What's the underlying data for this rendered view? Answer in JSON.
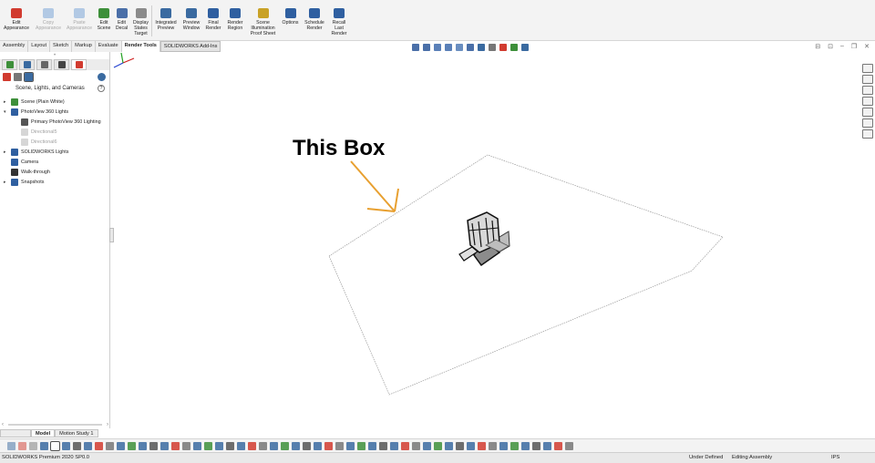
{
  "ribbon": {
    "buttons": [
      {
        "label": "Edit\nAppearance",
        "icon": "edit-appearance-icon",
        "enabled": true,
        "color": "#d13b2f"
      },
      {
        "label": "Copy\nAppearance",
        "icon": "copy-appearance-icon",
        "enabled": false,
        "color": "#3a7bc8"
      },
      {
        "label": "Paste\nAppearance",
        "icon": "paste-appearance-icon",
        "enabled": false,
        "color": "#3a7bc8"
      },
      {
        "label": "Edit\nScene",
        "icon": "edit-scene-icon",
        "enabled": true,
        "color": "#3d8f3a"
      },
      {
        "label": "Edit\nDecal",
        "icon": "edit-decal-icon",
        "enabled": true,
        "color": "#4a6fa8"
      },
      {
        "label": "Display\nStates\nTarget",
        "icon": "display-states-icon",
        "enabled": true,
        "color": "#8a8a8a"
      },
      {
        "label": "Integrated\nPreview",
        "icon": "integrated-preview-icon",
        "enabled": true,
        "color": "#3a6aa0"
      },
      {
        "label": "Preview\nWindow",
        "icon": "preview-window-icon",
        "enabled": true,
        "color": "#3a6aa0"
      },
      {
        "label": "Final\nRender",
        "icon": "final-render-icon",
        "enabled": true,
        "color": "#2f5fa0"
      },
      {
        "label": "Render\nRegion",
        "icon": "render-region-icon",
        "enabled": true,
        "color": "#2f5fa0"
      },
      {
        "label": "Scene\nIllumination\nProof Sheet",
        "icon": "proof-sheet-icon",
        "enabled": true,
        "color": "#c9a227"
      },
      {
        "label": "Options",
        "icon": "options-icon",
        "enabled": true,
        "color": "#2f5fa0"
      },
      {
        "label": "Schedule\nRender",
        "icon": "schedule-render-icon",
        "enabled": true,
        "color": "#2f5fa0"
      },
      {
        "label": "Recall\nLast\nRender",
        "icon": "recall-render-icon",
        "enabled": true,
        "color": "#2f5fa0"
      }
    ]
  },
  "tabs": [
    "Assembly",
    "Layout",
    "Sketch",
    "Markup",
    "Evaluate",
    "Render Tools",
    "SOLIDWORKS Add-Ins"
  ],
  "active_tab": "Render Tools",
  "window_controls": [
    "⊟",
    "⊡",
    "–",
    "❐",
    "✕"
  ],
  "fm_tabs": [
    "feature-manager-icon",
    "property-manager-icon",
    "configuration-manager-icon",
    "dimxpert-icon",
    "display-manager-icon"
  ],
  "fm_subbar": [
    "appearances-icon",
    "decals-icon",
    "scene-lights-cameras-icon"
  ],
  "panel": {
    "title": "Scene, Lights, and Cameras",
    "help": "?",
    "tree": [
      {
        "label": "Scene (Plain White)",
        "level": 0,
        "expander": "▸",
        "icon": "scene-icon",
        "color": "#3d8f3a",
        "dim": false
      },
      {
        "label": "PhotoView 360 Lights",
        "level": 0,
        "expander": "▾",
        "icon": "photoview-lights-icon",
        "color": "#2f5fa0",
        "dim": false
      },
      {
        "label": "Primary PhotoView 360 Lighting",
        "level": 1,
        "expander": "",
        "icon": "primary-lighting-icon",
        "color": "#555555",
        "dim": false
      },
      {
        "label": "Directional5",
        "level": 1,
        "expander": "",
        "icon": "directional-light-icon",
        "color": "#999999",
        "dim": true
      },
      {
        "label": "Directional6",
        "level": 1,
        "expander": "",
        "icon": "directional-light-icon",
        "color": "#999999",
        "dim": true
      },
      {
        "label": "SOLIDWORKS Lights",
        "level": 0,
        "expander": "▸",
        "icon": "solidworks-lights-icon",
        "color": "#2f5fa0",
        "dim": false
      },
      {
        "label": "Camera",
        "level": 0,
        "expander": "",
        "icon": "camera-icon",
        "color": "#2f5fa0",
        "dim": false
      },
      {
        "label": "Walk-through",
        "level": 0,
        "expander": "",
        "icon": "walk-through-icon",
        "color": "#333333",
        "dim": false
      },
      {
        "label": "Snapshots",
        "level": 0,
        "expander": "▸",
        "icon": "snapshots-icon",
        "color": "#2f5fa0",
        "dim": false
      }
    ]
  },
  "graphics": {
    "annotation_text": "This Box",
    "annotation_color": "#000000",
    "arrow_color": "#e8a030",
    "triad_colors": {
      "x": "#d02020",
      "y": "#20a020",
      "z": "#2040d0"
    }
  },
  "bottom_tabs": [
    "Model",
    "Motion Study 1"
  ],
  "active_bottom_tab": "Model",
  "status": {
    "product": "SOLIDWORKS Premium 2020 SP0.0",
    "state": "Under Defined",
    "mode": "Editing Assembly",
    "units": "IPS"
  }
}
